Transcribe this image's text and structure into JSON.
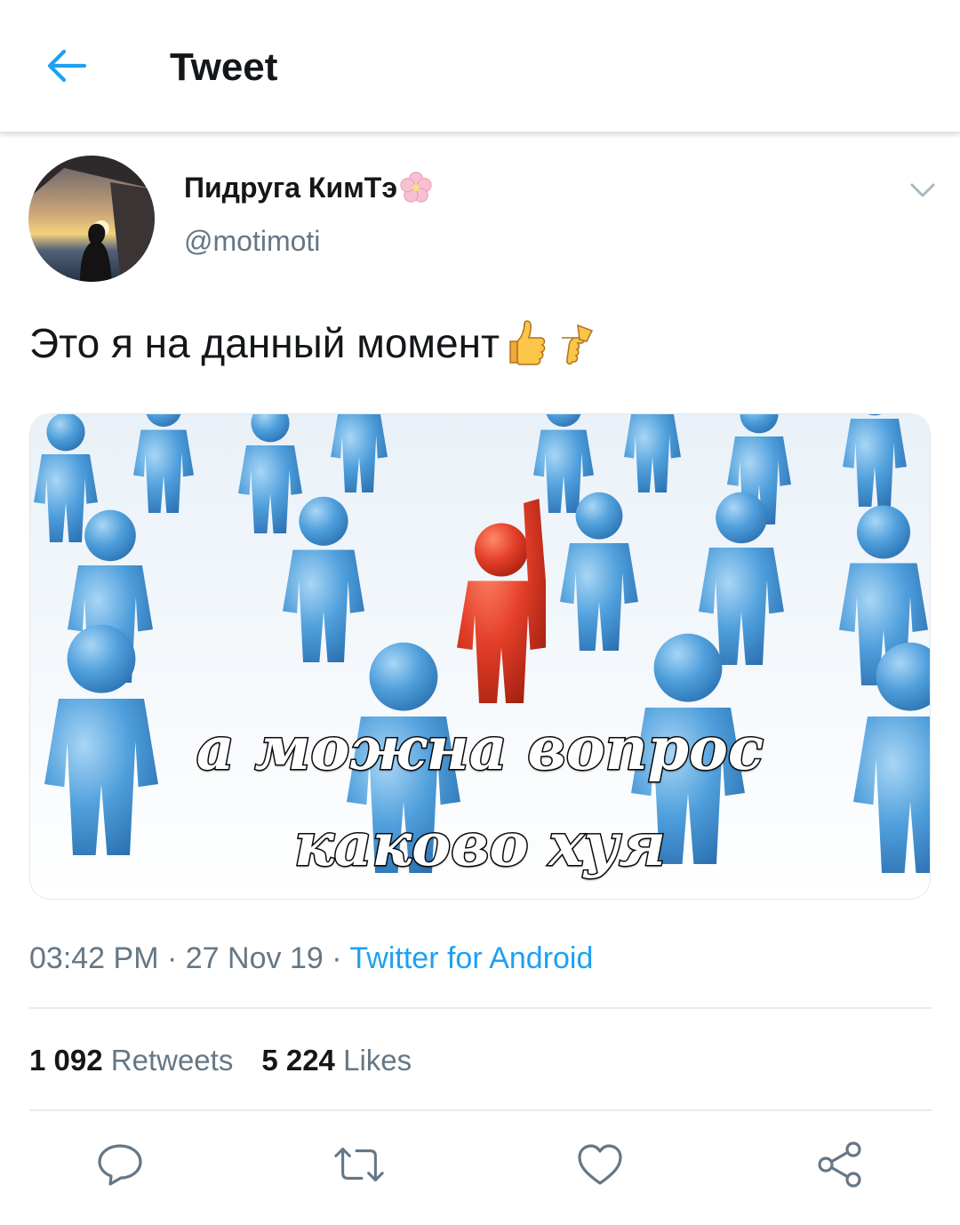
{
  "header": {
    "title": "Tweet",
    "back_icon": "arrow-left-icon"
  },
  "tweet": {
    "author_name": "Пидруга КимТэ",
    "handle": "@motimoti",
    "text": "Это я на данный момент",
    "text_emojis": [
      "thumbs-up-emoji",
      "backhand-index-pointing-left-emoji"
    ],
    "media": {
      "caption_line1": "а можна вопрос",
      "caption_line2": "каково хуя"
    },
    "time": "03:42 PM",
    "date": "27 Nov 19",
    "separator": "·",
    "source": "Twitter for Android",
    "retweets_count": "1 092",
    "retweets_label": "Retweets",
    "likes_count": "5 224",
    "likes_label": "Likes"
  },
  "actions": [
    "reply-icon",
    "retweet-icon",
    "like-icon",
    "share-icon"
  ],
  "colors": {
    "accent": "#1da1f2",
    "secondary_text": "#657786",
    "primary_text": "#14171a",
    "divider": "#e6ecf0"
  }
}
